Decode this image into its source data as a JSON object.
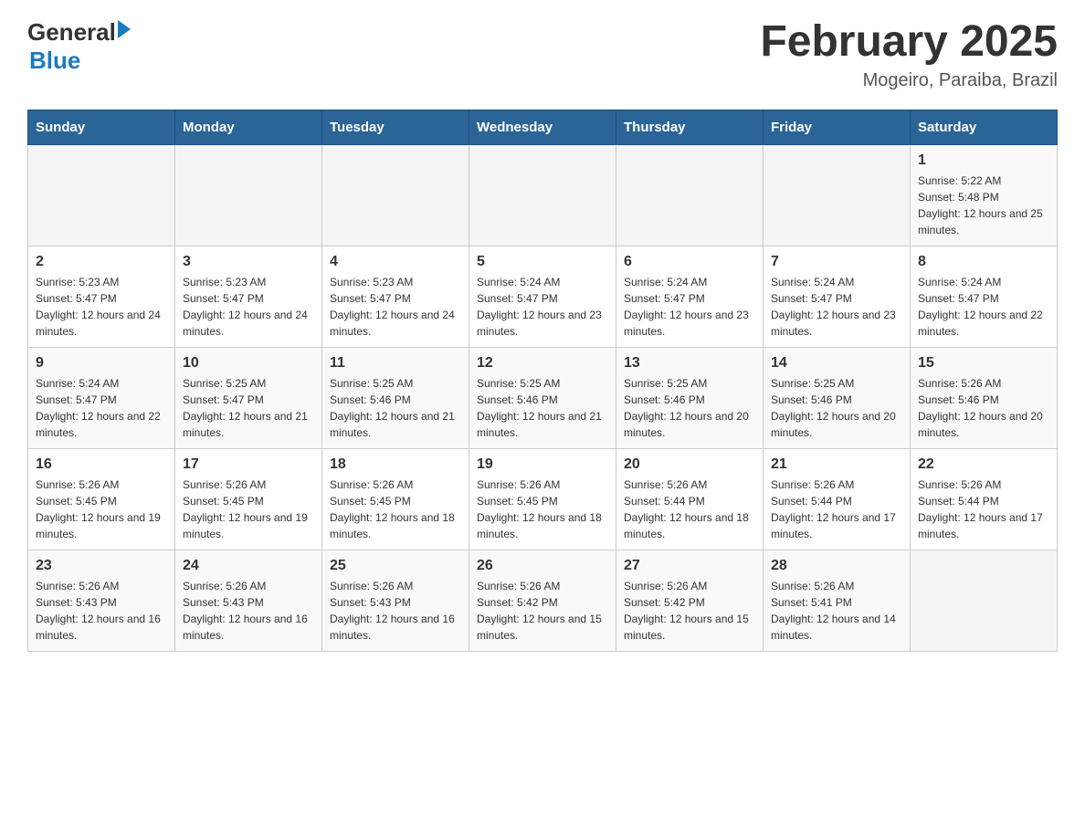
{
  "header": {
    "logo_general": "General",
    "logo_blue": "Blue",
    "month_title": "February 2025",
    "location": "Mogeiro, Paraiba, Brazil"
  },
  "weekdays": [
    "Sunday",
    "Monday",
    "Tuesday",
    "Wednesday",
    "Thursday",
    "Friday",
    "Saturday"
  ],
  "weeks": [
    [
      {
        "day": "",
        "sunrise": "",
        "sunset": "",
        "daylight": ""
      },
      {
        "day": "",
        "sunrise": "",
        "sunset": "",
        "daylight": ""
      },
      {
        "day": "",
        "sunrise": "",
        "sunset": "",
        "daylight": ""
      },
      {
        "day": "",
        "sunrise": "",
        "sunset": "",
        "daylight": ""
      },
      {
        "day": "",
        "sunrise": "",
        "sunset": "",
        "daylight": ""
      },
      {
        "day": "",
        "sunrise": "",
        "sunset": "",
        "daylight": ""
      },
      {
        "day": "1",
        "sunrise": "Sunrise: 5:22 AM",
        "sunset": "Sunset: 5:48 PM",
        "daylight": "Daylight: 12 hours and 25 minutes."
      }
    ],
    [
      {
        "day": "2",
        "sunrise": "Sunrise: 5:23 AM",
        "sunset": "Sunset: 5:47 PM",
        "daylight": "Daylight: 12 hours and 24 minutes."
      },
      {
        "day": "3",
        "sunrise": "Sunrise: 5:23 AM",
        "sunset": "Sunset: 5:47 PM",
        "daylight": "Daylight: 12 hours and 24 minutes."
      },
      {
        "day": "4",
        "sunrise": "Sunrise: 5:23 AM",
        "sunset": "Sunset: 5:47 PM",
        "daylight": "Daylight: 12 hours and 24 minutes."
      },
      {
        "day": "5",
        "sunrise": "Sunrise: 5:24 AM",
        "sunset": "Sunset: 5:47 PM",
        "daylight": "Daylight: 12 hours and 23 minutes."
      },
      {
        "day": "6",
        "sunrise": "Sunrise: 5:24 AM",
        "sunset": "Sunset: 5:47 PM",
        "daylight": "Daylight: 12 hours and 23 minutes."
      },
      {
        "day": "7",
        "sunrise": "Sunrise: 5:24 AM",
        "sunset": "Sunset: 5:47 PM",
        "daylight": "Daylight: 12 hours and 23 minutes."
      },
      {
        "day": "8",
        "sunrise": "Sunrise: 5:24 AM",
        "sunset": "Sunset: 5:47 PM",
        "daylight": "Daylight: 12 hours and 22 minutes."
      }
    ],
    [
      {
        "day": "9",
        "sunrise": "Sunrise: 5:24 AM",
        "sunset": "Sunset: 5:47 PM",
        "daylight": "Daylight: 12 hours and 22 minutes."
      },
      {
        "day": "10",
        "sunrise": "Sunrise: 5:25 AM",
        "sunset": "Sunset: 5:47 PM",
        "daylight": "Daylight: 12 hours and 21 minutes."
      },
      {
        "day": "11",
        "sunrise": "Sunrise: 5:25 AM",
        "sunset": "Sunset: 5:46 PM",
        "daylight": "Daylight: 12 hours and 21 minutes."
      },
      {
        "day": "12",
        "sunrise": "Sunrise: 5:25 AM",
        "sunset": "Sunset: 5:46 PM",
        "daylight": "Daylight: 12 hours and 21 minutes."
      },
      {
        "day": "13",
        "sunrise": "Sunrise: 5:25 AM",
        "sunset": "Sunset: 5:46 PM",
        "daylight": "Daylight: 12 hours and 20 minutes."
      },
      {
        "day": "14",
        "sunrise": "Sunrise: 5:25 AM",
        "sunset": "Sunset: 5:46 PM",
        "daylight": "Daylight: 12 hours and 20 minutes."
      },
      {
        "day": "15",
        "sunrise": "Sunrise: 5:26 AM",
        "sunset": "Sunset: 5:46 PM",
        "daylight": "Daylight: 12 hours and 20 minutes."
      }
    ],
    [
      {
        "day": "16",
        "sunrise": "Sunrise: 5:26 AM",
        "sunset": "Sunset: 5:45 PM",
        "daylight": "Daylight: 12 hours and 19 minutes."
      },
      {
        "day": "17",
        "sunrise": "Sunrise: 5:26 AM",
        "sunset": "Sunset: 5:45 PM",
        "daylight": "Daylight: 12 hours and 19 minutes."
      },
      {
        "day": "18",
        "sunrise": "Sunrise: 5:26 AM",
        "sunset": "Sunset: 5:45 PM",
        "daylight": "Daylight: 12 hours and 18 minutes."
      },
      {
        "day": "19",
        "sunrise": "Sunrise: 5:26 AM",
        "sunset": "Sunset: 5:45 PM",
        "daylight": "Daylight: 12 hours and 18 minutes."
      },
      {
        "day": "20",
        "sunrise": "Sunrise: 5:26 AM",
        "sunset": "Sunset: 5:44 PM",
        "daylight": "Daylight: 12 hours and 18 minutes."
      },
      {
        "day": "21",
        "sunrise": "Sunrise: 5:26 AM",
        "sunset": "Sunset: 5:44 PM",
        "daylight": "Daylight: 12 hours and 17 minutes."
      },
      {
        "day": "22",
        "sunrise": "Sunrise: 5:26 AM",
        "sunset": "Sunset: 5:44 PM",
        "daylight": "Daylight: 12 hours and 17 minutes."
      }
    ],
    [
      {
        "day": "23",
        "sunrise": "Sunrise: 5:26 AM",
        "sunset": "Sunset: 5:43 PM",
        "daylight": "Daylight: 12 hours and 16 minutes."
      },
      {
        "day": "24",
        "sunrise": "Sunrise: 5:26 AM",
        "sunset": "Sunset: 5:43 PM",
        "daylight": "Daylight: 12 hours and 16 minutes."
      },
      {
        "day": "25",
        "sunrise": "Sunrise: 5:26 AM",
        "sunset": "Sunset: 5:43 PM",
        "daylight": "Daylight: 12 hours and 16 minutes."
      },
      {
        "day": "26",
        "sunrise": "Sunrise: 5:26 AM",
        "sunset": "Sunset: 5:42 PM",
        "daylight": "Daylight: 12 hours and 15 minutes."
      },
      {
        "day": "27",
        "sunrise": "Sunrise: 5:26 AM",
        "sunset": "Sunset: 5:42 PM",
        "daylight": "Daylight: 12 hours and 15 minutes."
      },
      {
        "day": "28",
        "sunrise": "Sunrise: 5:26 AM",
        "sunset": "Sunset: 5:41 PM",
        "daylight": "Daylight: 12 hours and 14 minutes."
      },
      {
        "day": "",
        "sunrise": "",
        "sunset": "",
        "daylight": ""
      }
    ]
  ]
}
